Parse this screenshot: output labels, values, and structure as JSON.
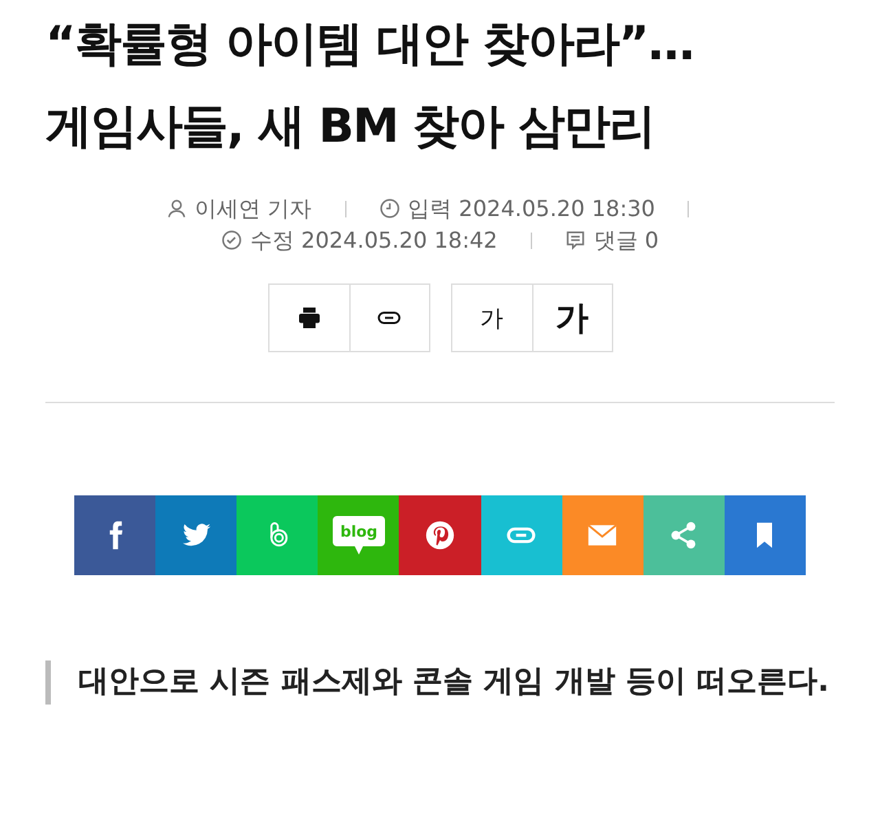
{
  "headline": [
    "“확률형 아이템 대안 찾아라”…",
    "게임사들, 새 BM 찾아 삼만리"
  ],
  "byline": {
    "author": "이세연 기자",
    "entered": "입력 2024.05.20 18:30",
    "edited": "수정 2024.05.20 18:42",
    "comments": "댓글 0"
  },
  "tools": [
    {
      "kind": "print"
    },
    {
      "kind": "link"
    }
  ],
  "font_sizes": [
    {
      "label": "가",
      "kind": "small"
    },
    {
      "label": "가",
      "kind": "large"
    }
  ],
  "share": [
    {
      "kind": "facebook",
      "color": "#3b5998"
    },
    {
      "kind": "twitter",
      "color": "#0e7ab8"
    },
    {
      "kind": "band",
      "color": "#0bc85c"
    },
    {
      "kind": "blog",
      "color": "#2eb70d",
      "icon_text": "blog"
    },
    {
      "kind": "pinterest",
      "color": "#cb1f27"
    },
    {
      "kind": "link",
      "color": "#18bfd1"
    },
    {
      "kind": "mail",
      "color": "#fb8a26"
    },
    {
      "kind": "share",
      "color": "#4cbf9a"
    },
    {
      "kind": "bookmark",
      "color": "#2a78d1"
    }
  ],
  "subtitle": "대안으로 시즌 패스제와 콘솔 게임 개발 등이 떠오른다."
}
